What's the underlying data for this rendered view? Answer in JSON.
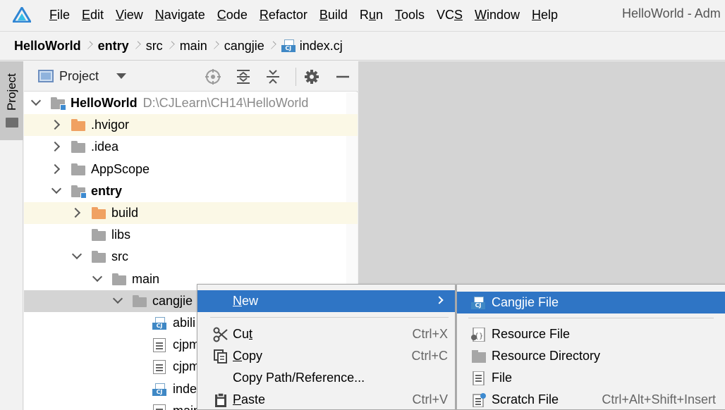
{
  "menubar": {
    "items": [
      {
        "u": "F",
        "rest": "ile"
      },
      {
        "u": "E",
        "rest": "dit"
      },
      {
        "u": "V",
        "rest": "iew"
      },
      {
        "u": "N",
        "rest": "avigate"
      },
      {
        "u": "C",
        "rest": "ode"
      },
      {
        "u": "R",
        "rest": "efactor"
      },
      {
        "u": "B",
        "rest": "uild"
      },
      {
        "pre": "R",
        "u": "u",
        "rest": "n"
      },
      {
        "u": "T",
        "rest": "ools"
      },
      {
        "pre": "VC",
        "u": "S",
        "rest": ""
      },
      {
        "u": "W",
        "rest": "indow"
      },
      {
        "u": "H",
        "rest": "elp"
      }
    ],
    "window_title": "HelloWorld - Adm"
  },
  "breadcrumb": {
    "items": [
      "HelloWorld",
      "entry",
      "src",
      "main",
      "cangjie"
    ],
    "file": "index.cj",
    "file_icon_tag": "CJ"
  },
  "toolstrip": {
    "project_label": "Project"
  },
  "panel": {
    "title": "Project",
    "tree": [
      {
        "label": "HelloWorld",
        "hint": "D:\\CJLearn\\CH14\\HelloWorld",
        "bold": true,
        "kind": "module",
        "expanded": true
      },
      {
        "label": ".hvigor",
        "kind": "orange",
        "collapsed": true
      },
      {
        "label": ".idea",
        "kind": "gray",
        "collapsed": true
      },
      {
        "label": "AppScope",
        "kind": "gray",
        "collapsed": true
      },
      {
        "label": "entry",
        "bold": true,
        "kind": "module",
        "expanded": true
      },
      {
        "label": "build",
        "kind": "orange",
        "collapsed": true
      },
      {
        "label": "libs",
        "kind": "gray"
      },
      {
        "label": "src",
        "kind": "gray",
        "expanded": true
      },
      {
        "label": "main",
        "kind": "gray",
        "expanded": true
      },
      {
        "label": "cangjie",
        "kind": "gray",
        "expanded": true
      },
      {
        "label": "abili",
        "kind": "cj"
      },
      {
        "label": "cjpm",
        "kind": "file"
      },
      {
        "label": "cjpm",
        "kind": "file"
      },
      {
        "label": "inde",
        "kind": "cj"
      },
      {
        "label": "main",
        "kind": "file"
      }
    ]
  },
  "context_menu": {
    "items": [
      {
        "u": "N",
        "rest": "ew",
        "shortcut": "",
        "highlighted": true,
        "icon": "none-icon"
      },
      {
        "u": "",
        "pre": "Cu",
        "u2": "t",
        "rest": "",
        "shortcut": "Ctrl+X",
        "icon": "scissors-icon"
      },
      {
        "pre": "",
        "u": "C",
        "rest": "opy",
        "shortcut": "Ctrl+C",
        "icon": "copy-icon"
      },
      {
        "pre": "Copy Path/Reference...",
        "u": "",
        "rest": "",
        "shortcut": "",
        "icon": "none-icon"
      },
      {
        "pre": "",
        "u": "P",
        "rest": "aste",
        "shortcut": "Ctrl+V",
        "icon": "clipboard-icon"
      }
    ]
  },
  "submenu": {
    "items": [
      {
        "label": "Cangjie File",
        "shortcut": "",
        "highlighted": true,
        "icon": "cangjie-file-icon"
      },
      {
        "label": "Resource File",
        "shortcut": "",
        "icon": "resource-file-icon"
      },
      {
        "label": "Resource Directory",
        "shortcut": "",
        "icon": "resource-directory-icon"
      },
      {
        "label": "File",
        "shortcut": "",
        "icon": "file-icon"
      },
      {
        "label": "Scratch File",
        "shortcut": "Ctrl+Alt+Shift+Insert",
        "icon": "scratch-file-icon"
      }
    ]
  },
  "colors": {
    "highlight": "#2f75c5",
    "excluded_row": "#fbf8e6",
    "selected_row": "#d4d4d4",
    "editor_bg": "#d4d4d4"
  }
}
